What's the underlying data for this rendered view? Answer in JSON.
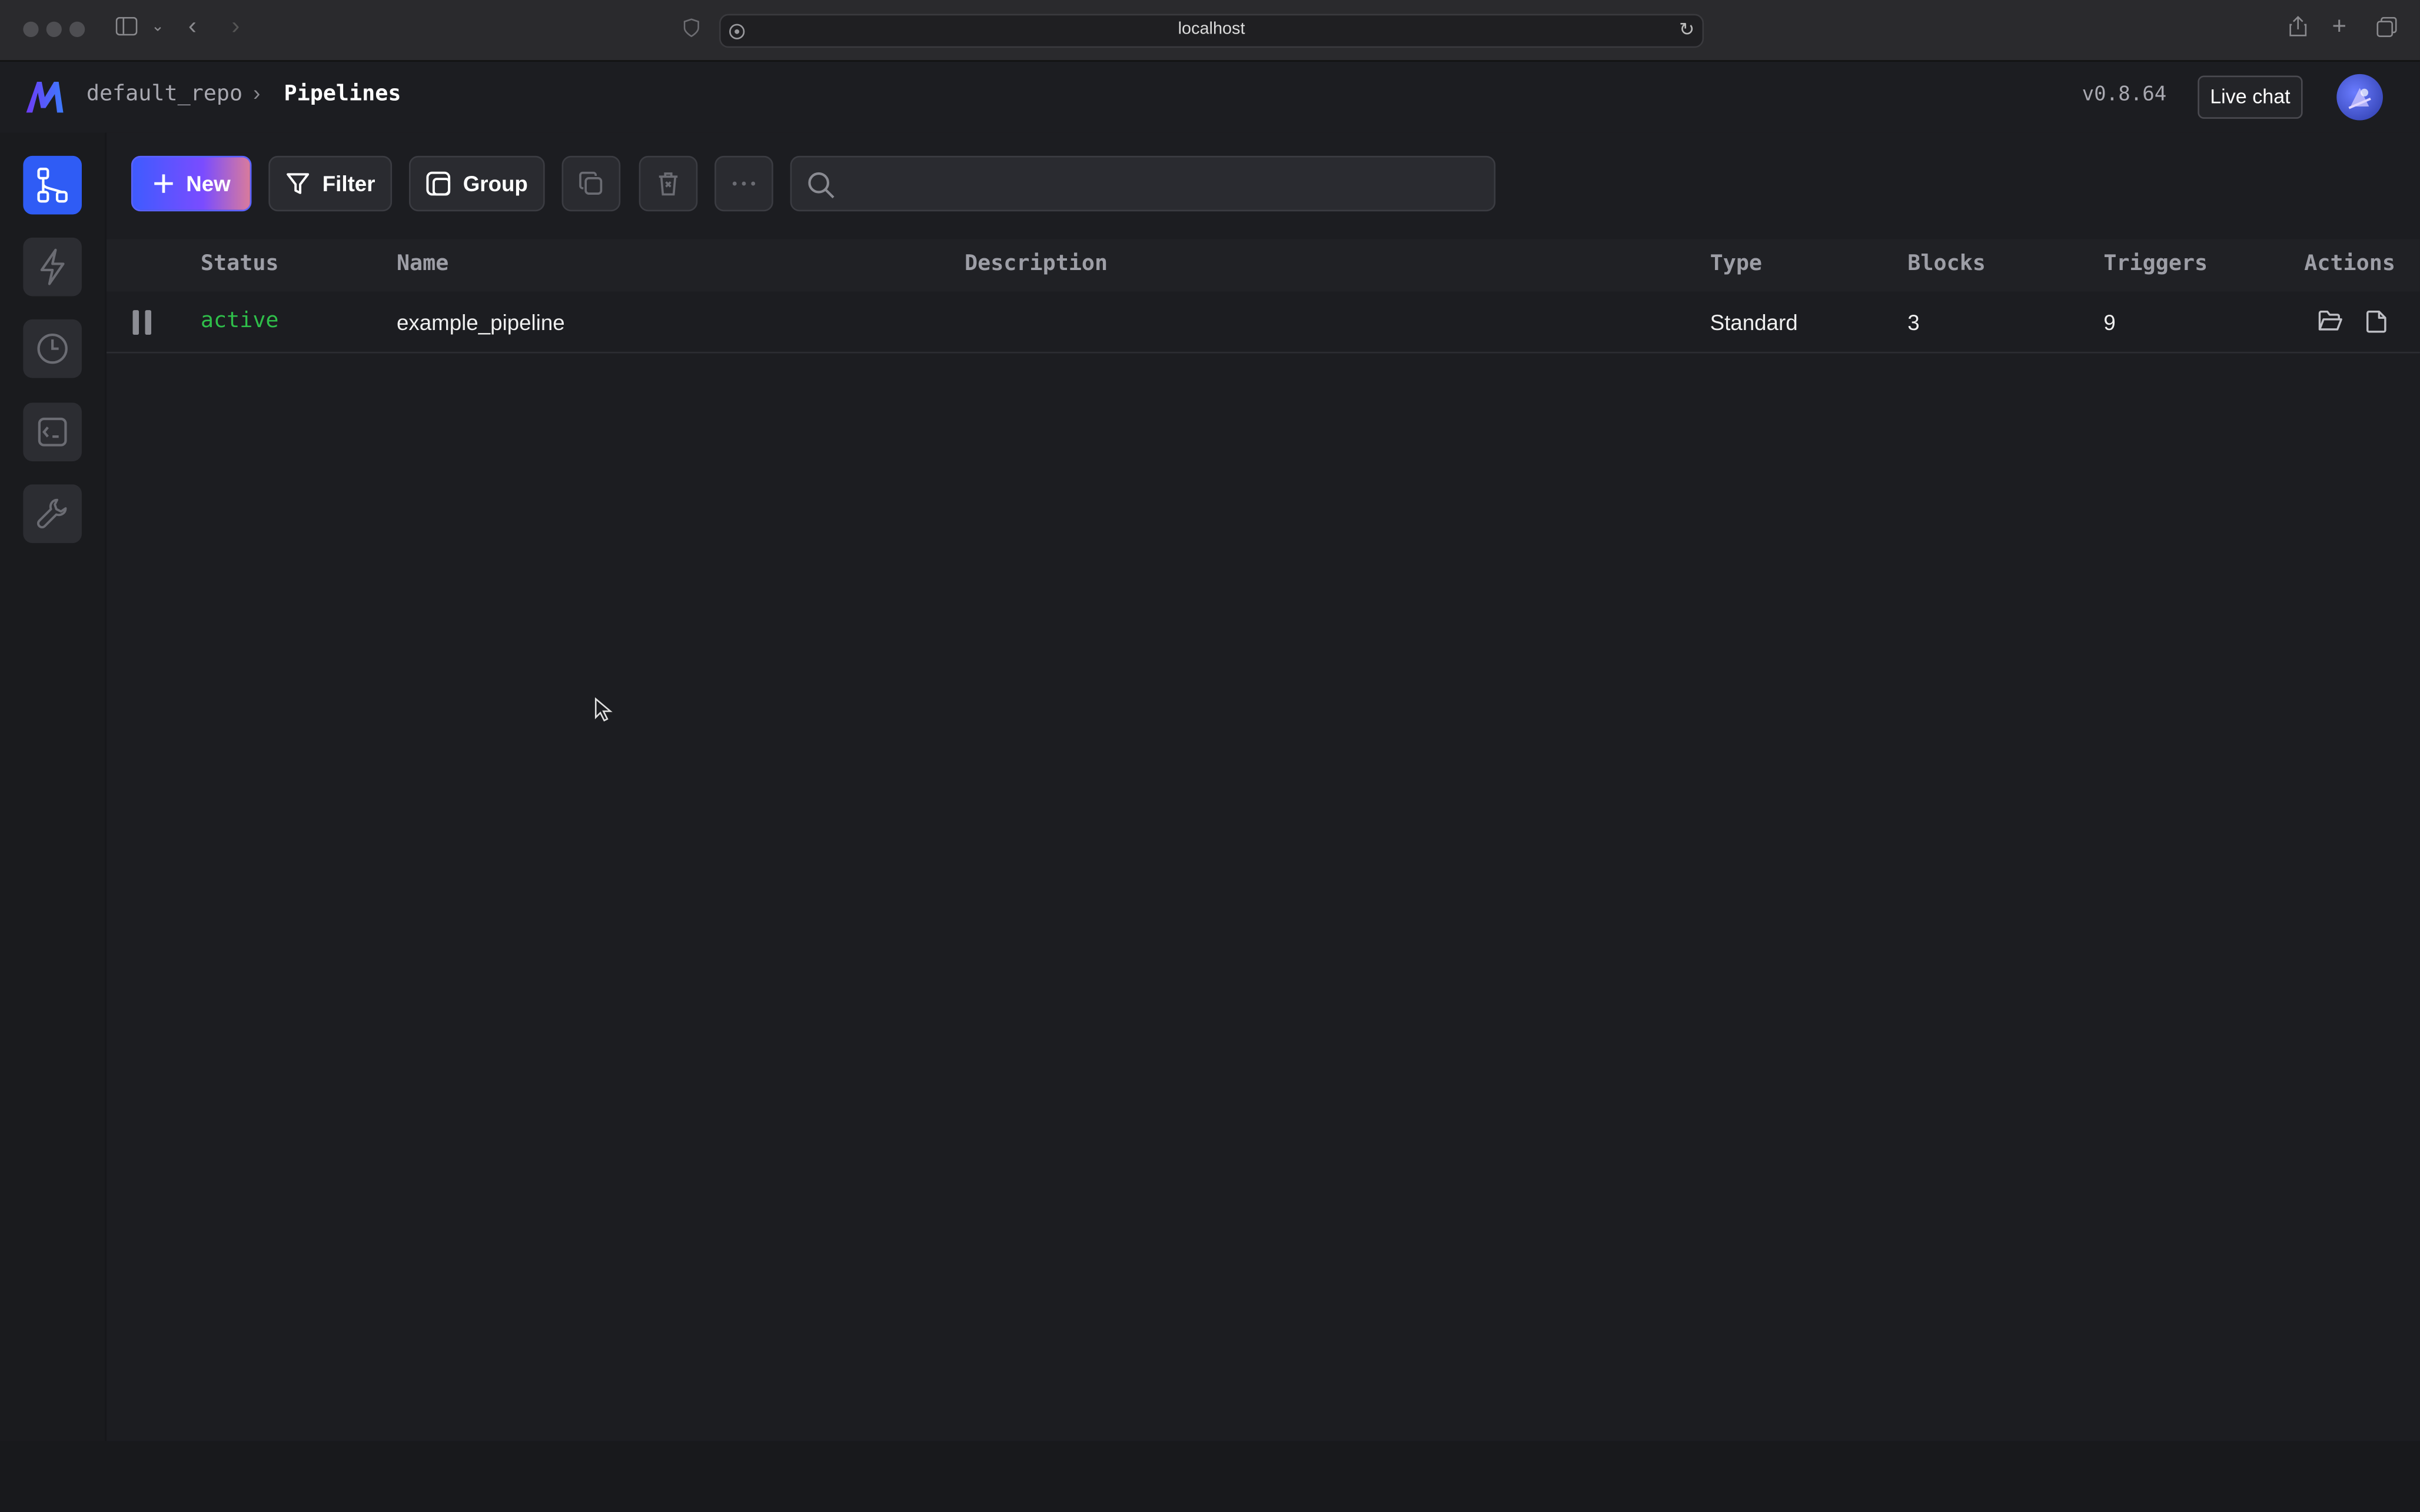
{
  "browser": {
    "url": "localhost"
  },
  "header": {
    "repo": "default_repo",
    "page_title": "Pipelines",
    "version": "v0.8.64",
    "live_chat_label": "Live chat"
  },
  "sidebar": {
    "items": [
      {
        "name": "pipelines",
        "icon": "pipeline-icon",
        "active": true
      },
      {
        "name": "triggers",
        "icon": "lightning-icon",
        "active": false
      },
      {
        "name": "pipeline-runs",
        "icon": "clock-icon",
        "active": false
      },
      {
        "name": "terminal",
        "icon": "terminal-icon",
        "active": false
      },
      {
        "name": "settings",
        "icon": "wrench-icon",
        "active": false
      }
    ]
  },
  "toolbar": {
    "new_label": "New",
    "filter_label": "Filter",
    "group_label": "Group",
    "search_placeholder": ""
  },
  "table": {
    "columns": [
      "Status",
      "Name",
      "Description",
      "Type",
      "Blocks",
      "Triggers",
      "Actions"
    ],
    "rows": [
      {
        "status": "active",
        "name": "example_pipeline",
        "description": "",
        "type": "Standard",
        "blocks": "3",
        "triggers": "9"
      }
    ]
  },
  "colors": {
    "accent": "#2f5cf5",
    "status_active": "#2fbf4a",
    "background": "#1c1d21"
  }
}
